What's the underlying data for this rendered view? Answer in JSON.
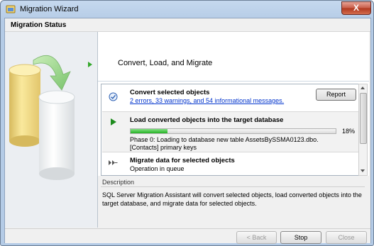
{
  "window": {
    "title": "Migration Wizard",
    "close_label": "X"
  },
  "header": {
    "title": "Migration Status"
  },
  "page": {
    "title": "Convert, Load, and Migrate"
  },
  "steps": [
    {
      "title": "Convert selected objects",
      "link": "2 errors, 33 warnings, and 54 informational messages.",
      "button": "Report",
      "status": "done"
    },
    {
      "title": "Load converted objects into the target database",
      "progress": {
        "value": 0.18,
        "label": "18%"
      },
      "detail": "Phase 0: Loading to database new table AssetsBySSMA0123.dbo.[Contacts] primary keys",
      "status": "in-progress"
    },
    {
      "title": "Migrate data for selected objects",
      "detail": "Operation in queue",
      "status": "queued"
    }
  ],
  "description": {
    "label": "Description",
    "text": "SQL Server Migration Assistant will convert selected objects, load converted objects into the target database, and migrate data for selected objects."
  },
  "footer": {
    "back": "< Back",
    "stop": "Stop",
    "close": "Close"
  },
  "colors": {
    "progress": "#25b225",
    "link": "#0033cc",
    "accent_arrow": "#35a82c"
  }
}
